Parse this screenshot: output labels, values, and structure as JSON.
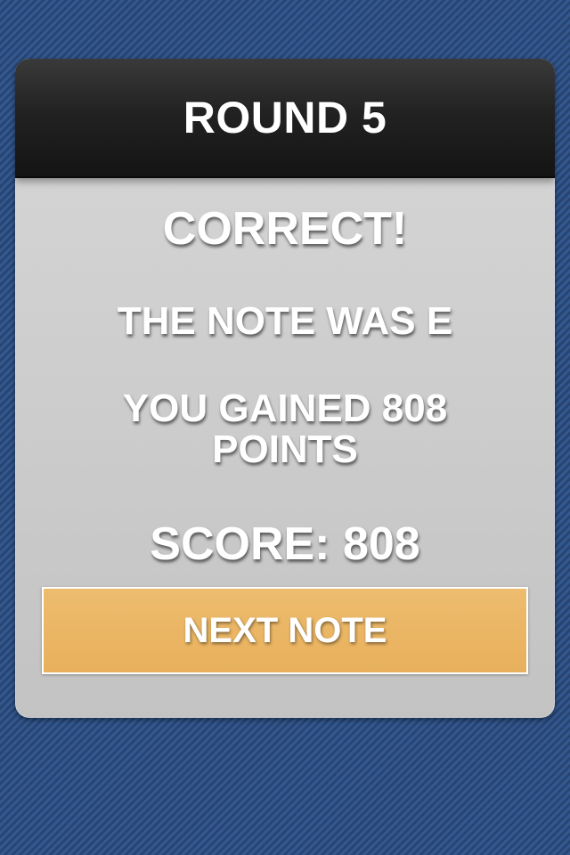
{
  "header": {
    "title": "ROUND 5"
  },
  "result": {
    "status": "CORRECT!",
    "note_message": "THE NOTE WAS E",
    "points_message_line1": "YOU GAINED 808",
    "points_message_line2": "POINTS",
    "score_text": "SCORE: 808"
  },
  "actions": {
    "next_label": "NEXT NOTE"
  },
  "colors": {
    "background": "#2d4f82",
    "button": "#ebb565",
    "header": "#1e1e1e",
    "card": "#cfcfcf"
  }
}
